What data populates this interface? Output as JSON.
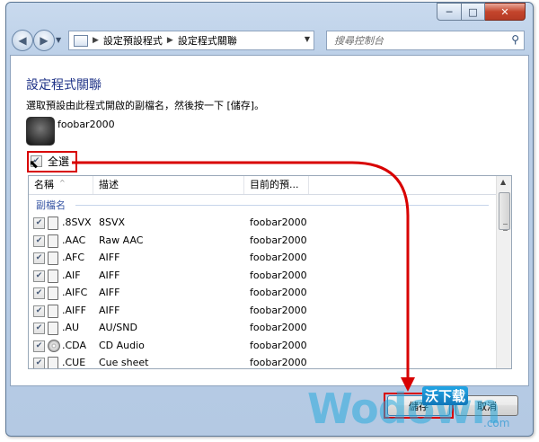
{
  "window": {
    "minimize": "─",
    "maximize": "□",
    "close": "✕"
  },
  "nav": {
    "breadcrumb": [
      "設定預設程式",
      "設定程式關聯"
    ],
    "search_placeholder": "搜尋控制台"
  },
  "page": {
    "title": "設定程式關聯",
    "description": "選取預設由此程式開啟的副檔名，然後按一下 [儲存]。",
    "app_name": "foobar2000",
    "select_all": "全選"
  },
  "list": {
    "columns": [
      "名稱",
      "描述",
      "目前的預..."
    ],
    "group": "副檔名",
    "rows": [
      {
        "ext": ".8SVX",
        "desc": "8SVX",
        "current": "foobar2000",
        "icon": "audio-file-icon"
      },
      {
        "ext": ".AAC",
        "desc": "Raw AAC",
        "current": "foobar2000",
        "icon": "audio-file-icon"
      },
      {
        "ext": ".AFC",
        "desc": "AIFF",
        "current": "foobar2000",
        "icon": "audio-file-icon"
      },
      {
        "ext": ".AIF",
        "desc": "AIFF",
        "current": "foobar2000",
        "icon": "audio-file-icon"
      },
      {
        "ext": ".AIFC",
        "desc": "AIFF",
        "current": "foobar2000",
        "icon": "audio-file-icon"
      },
      {
        "ext": ".AIFF",
        "desc": "AIFF",
        "current": "foobar2000",
        "icon": "audio-file-icon"
      },
      {
        "ext": ".AU",
        "desc": "AU/SND",
        "current": "foobar2000",
        "icon": "audio-file-icon"
      },
      {
        "ext": ".CDA",
        "desc": "CD Audio",
        "current": "foobar2000",
        "icon": "cd-icon"
      },
      {
        "ext": ".CUE",
        "desc": "Cue sheet",
        "current": "foobar2000",
        "icon": "document-icon"
      }
    ]
  },
  "buttons": {
    "save": "儲存",
    "cancel": "取消"
  },
  "watermark": {
    "text": "Wodown",
    "badge": "沃下载",
    "suffix": ".com"
  },
  "colors": {
    "highlight": "#d80000",
    "title": "#1e3287",
    "group": "#3654a3"
  }
}
